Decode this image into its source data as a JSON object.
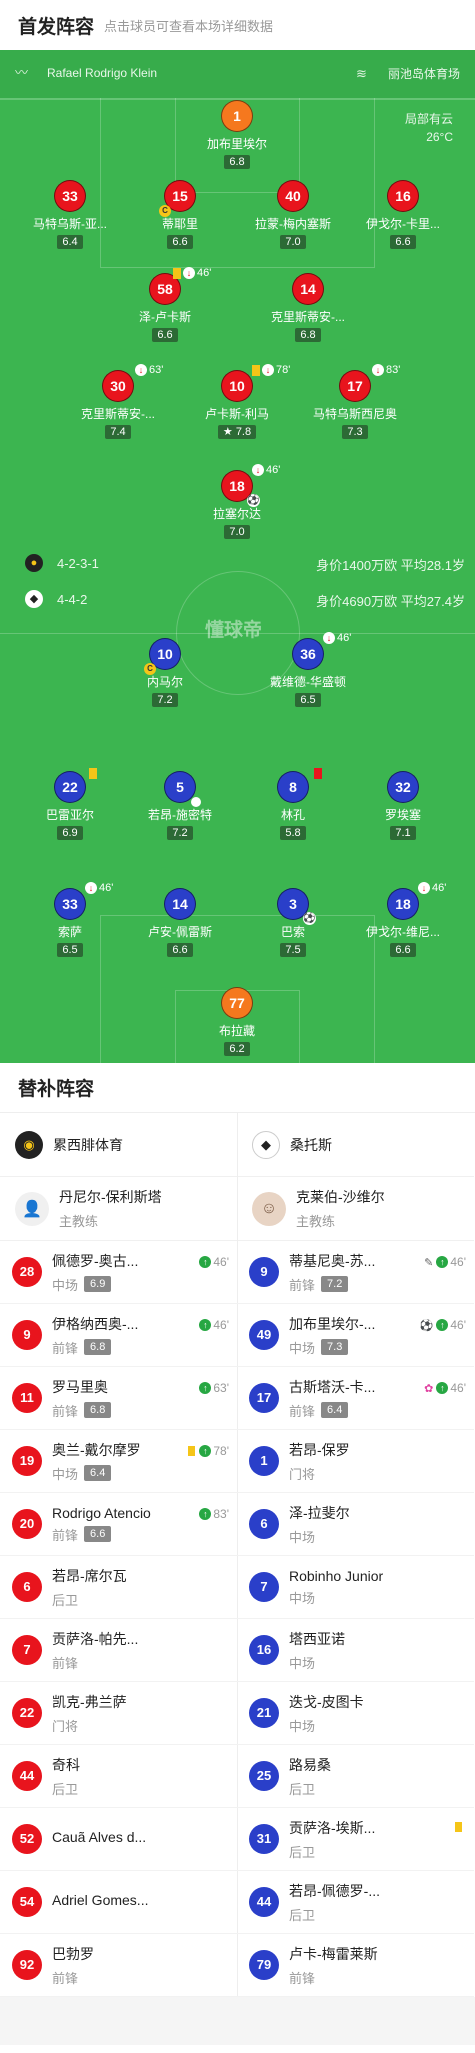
{
  "header": {
    "title": "首发阵容",
    "subtitle": "点击球员可查看本场详细数据"
  },
  "pitch_info": {
    "referee_icon": "whistle-icon",
    "referee": "Rafael Rodrigo Klein",
    "venue_icon": "stadium-icon",
    "venue": "丽池岛体育场",
    "weather": "局部有云",
    "temperature": "26°C",
    "home_formation": "4-2-3-1",
    "home_value": "身价1400万欧 平均28.1岁",
    "away_formation": "4-4-2",
    "away_value": "身价4690万欧 平均27.4岁",
    "watermark": "懂球帝",
    "home_color": "#e8141d",
    "away_color": "#2a3fc9",
    "goalkeeper_color": "#f5781e"
  },
  "home_players": [
    {
      "num": "1",
      "name": "加布里埃尔",
      "rating": "6.8",
      "color": "orange"
    },
    {
      "num": "33",
      "name": "马特乌斯-亚...",
      "rating": "6.4"
    },
    {
      "num": "15",
      "name": "蒂耶里",
      "rating": "6.6",
      "captain": "C"
    },
    {
      "num": "40",
      "name": "拉蒙-梅内塞斯",
      "rating": "7.0"
    },
    {
      "num": "16",
      "name": "伊戈尔-卡里...",
      "rating": "6.6"
    },
    {
      "num": "58",
      "name": "泽-卢卡斯",
      "rating": "6.6",
      "event": "46'"
    },
    {
      "num": "14",
      "name": "克里斯蒂安-...",
      "rating": "6.8"
    },
    {
      "num": "30",
      "name": "克里斯蒂安-...",
      "rating": "7.4",
      "event": "63'"
    },
    {
      "num": "10",
      "name": "卢卡斯-利马",
      "rating": "7.8",
      "event": "78'"
    },
    {
      "num": "17",
      "name": "马特乌斯西尼奥",
      "rating": "7.3",
      "event": "83'"
    },
    {
      "num": "18",
      "name": "拉塞尔达",
      "rating": "7.0",
      "event": "46'"
    }
  ],
  "away_players": [
    {
      "num": "10",
      "name": "内马尔",
      "rating": "7.2",
      "captain": "C"
    },
    {
      "num": "36",
      "name": "戴维德-华盛顿",
      "rating": "6.5",
      "event": "46'"
    },
    {
      "num": "22",
      "name": "巴雷亚尔",
      "rating": "6.9"
    },
    {
      "num": "5",
      "name": "若昂-施密特",
      "rating": "7.2"
    },
    {
      "num": "8",
      "name": "林孔",
      "rating": "5.8"
    },
    {
      "num": "32",
      "name": "罗埃塞",
      "rating": "7.1"
    },
    {
      "num": "33",
      "name": "索萨",
      "rating": "6.5",
      "event": "46'"
    },
    {
      "num": "14",
      "name": "卢安-佩雷斯",
      "rating": "6.6"
    },
    {
      "num": "3",
      "name": "巴索",
      "rating": "7.5"
    },
    {
      "num": "18",
      "name": "伊戈尔-维尼...",
      "rating": "6.6",
      "event": "46'"
    },
    {
      "num": "77",
      "name": "布拉藏",
      "rating": "6.2",
      "color": "orange"
    }
  ],
  "subs": {
    "title": "替补阵容",
    "home_team": "累西腓体育",
    "away_team": "桑托斯",
    "home_coach": "丹尼尔-保利斯塔",
    "away_coach": "克莱伯-沙维尔",
    "coach_role": "主教练",
    "home": [
      {
        "num": "28",
        "name": "佩德罗-奥古...",
        "pos": "中场",
        "rating": "6.9",
        "event": "46'"
      },
      {
        "num": "9",
        "name": "伊格纳西奥-...",
        "pos": "前锋",
        "rating": "6.8",
        "event": "46'"
      },
      {
        "num": "11",
        "name": "罗马里奥",
        "pos": "前锋",
        "rating": "6.8",
        "event": "63'"
      },
      {
        "num": "19",
        "name": "奥兰-戴尔摩罗",
        "pos": "中场",
        "rating": "6.4",
        "event": "78'"
      },
      {
        "num": "20",
        "name": "Rodrigo Atencio",
        "pos": "前锋",
        "rating": "6.6",
        "event": "83'"
      },
      {
        "num": "6",
        "name": "若昂-席尔瓦",
        "pos": "后卫"
      },
      {
        "num": "7",
        "name": "贡萨洛-帕先...",
        "pos": "前锋"
      },
      {
        "num": "22",
        "name": "凯克-弗兰萨",
        "pos": "门将"
      },
      {
        "num": "44",
        "name": "奇科",
        "pos": "后卫"
      },
      {
        "num": "52",
        "name": "Cauã Alves d...",
        "pos": ""
      },
      {
        "num": "54",
        "name": "Adriel Gomes...",
        "pos": ""
      },
      {
        "num": "92",
        "name": "巴勃罗",
        "pos": "前锋"
      }
    ],
    "away": [
      {
        "num": "9",
        "name": "蒂基尼奥-苏...",
        "pos": "前锋",
        "rating": "7.2",
        "event": "46'"
      },
      {
        "num": "49",
        "name": "加布里埃尔-...",
        "pos": "中场",
        "rating": "7.3",
        "event": "46'"
      },
      {
        "num": "17",
        "name": "古斯塔沃-卡...",
        "pos": "前锋",
        "rating": "6.4",
        "event": "46'"
      },
      {
        "num": "1",
        "name": "若昂-保罗",
        "pos": "门将"
      },
      {
        "num": "6",
        "name": "泽-拉斐尔",
        "pos": "中场"
      },
      {
        "num": "7",
        "name": "Robinho Junior",
        "pos": "中场"
      },
      {
        "num": "16",
        "name": "塔西亚诺",
        "pos": "中场"
      },
      {
        "num": "21",
        "name": "迭戈-皮图卡",
        "pos": "中场"
      },
      {
        "num": "25",
        "name": "路易桑",
        "pos": "后卫"
      },
      {
        "num": "31",
        "name": "贡萨洛-埃斯...",
        "pos": "后卫"
      },
      {
        "num": "44",
        "name": "若昂-佩德罗-...",
        "pos": "后卫"
      },
      {
        "num": "79",
        "name": "卢卡-梅雷莱斯",
        "pos": "前锋"
      }
    ]
  }
}
